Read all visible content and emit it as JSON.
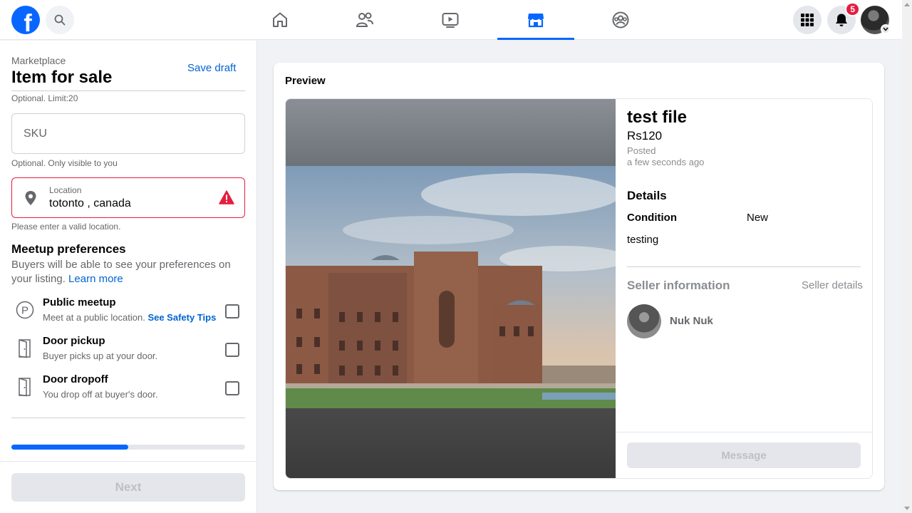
{
  "topnav": {
    "logo_letter": "f",
    "notification_count": "5",
    "tabs": [
      {
        "name": "home",
        "icon": "home-icon",
        "active": false
      },
      {
        "name": "friends",
        "icon": "friends-icon",
        "active": false
      },
      {
        "name": "watch",
        "icon": "video-play-icon",
        "active": false
      },
      {
        "name": "marketplace",
        "icon": "marketplace-store-icon",
        "active": true
      },
      {
        "name": "groups",
        "icon": "groups-icon",
        "active": false
      }
    ],
    "accent": "#0866ff"
  },
  "left_panel": {
    "breadcrumb": "Marketplace",
    "title": "Item for sale",
    "save_draft": "Save draft",
    "sku_hint": "Optional. Limit:20",
    "sku_placeholder": "SKU",
    "location_hint": "Optional. Only visible to you",
    "location_label": "Location",
    "location_value": "totonto , canada",
    "location_error": "Please enter a valid location.",
    "meetup_title": "Meetup preferences",
    "meetup_desc": "Buyers will be able to see your preferences on your listing.",
    "learn_more": "Learn more",
    "options": [
      {
        "title": "Public meetup",
        "sub": "Meet at a public location.",
        "link": "See Safety Tips",
        "checked": false
      },
      {
        "title": "Door pickup",
        "sub": "Buyer picks up at your door.",
        "checked": false
      },
      {
        "title": "Door dropoff",
        "sub": "You drop off at buyer's door.",
        "checked": false
      }
    ],
    "progress_fraction": 0.5,
    "next_label": "Next"
  },
  "preview": {
    "label": "Preview",
    "item_title": "test file",
    "price": "Rs120",
    "posted_label": "Posted",
    "posted_time": "a few seconds ago",
    "details_heading": "Details",
    "condition_label": "Condition",
    "condition_value": "New",
    "description": "testing",
    "seller_heading": "Seller information",
    "seller_details_link": "Seller details",
    "seller_name": "Nuk Nuk",
    "message_button": "Message"
  }
}
